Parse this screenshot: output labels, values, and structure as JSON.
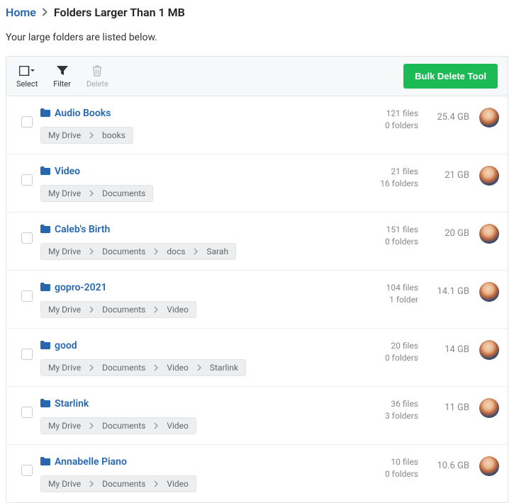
{
  "breadcrumb": {
    "home": "Home",
    "current": "Folders Larger Than 1 MB"
  },
  "subtitle": "Your large folders are listed below.",
  "toolbar": {
    "select": "Select",
    "filter": "Filter",
    "delete": "Delete",
    "bulk": "Bulk Delete Tool"
  },
  "rows": [
    {
      "name": "Audio Books",
      "path": [
        "My Drive",
        "books"
      ],
      "files": "121 files",
      "folders": "0 folders",
      "size": "25.4 GB"
    },
    {
      "name": "Video",
      "path": [
        "My Drive",
        "Documents"
      ],
      "files": "21 files",
      "folders": "16 folders",
      "size": "21 GB"
    },
    {
      "name": "Caleb's Birth",
      "path": [
        "My Drive",
        "Documents",
        "docs",
        "Sarah"
      ],
      "files": "151 files",
      "folders": "0 folders",
      "size": "20 GB"
    },
    {
      "name": "gopro-2021",
      "path": [
        "My Drive",
        "Documents",
        "Video"
      ],
      "files": "104 files",
      "folders": "1 folder",
      "size": "14.1 GB"
    },
    {
      "name": "good",
      "path": [
        "My Drive",
        "Documents",
        "Video",
        "Starlink"
      ],
      "files": "20 files",
      "folders": "0 folders",
      "size": "14 GB"
    },
    {
      "name": "Starlink",
      "path": [
        "My Drive",
        "Documents",
        "Video"
      ],
      "files": "36 files",
      "folders": "3 folders",
      "size": "11 GB"
    },
    {
      "name": "Annabelle Piano",
      "path": [
        "My Drive",
        "Documents",
        "Video"
      ],
      "files": "10 files",
      "folders": "0 folders",
      "size": "10.6 GB"
    }
  ]
}
